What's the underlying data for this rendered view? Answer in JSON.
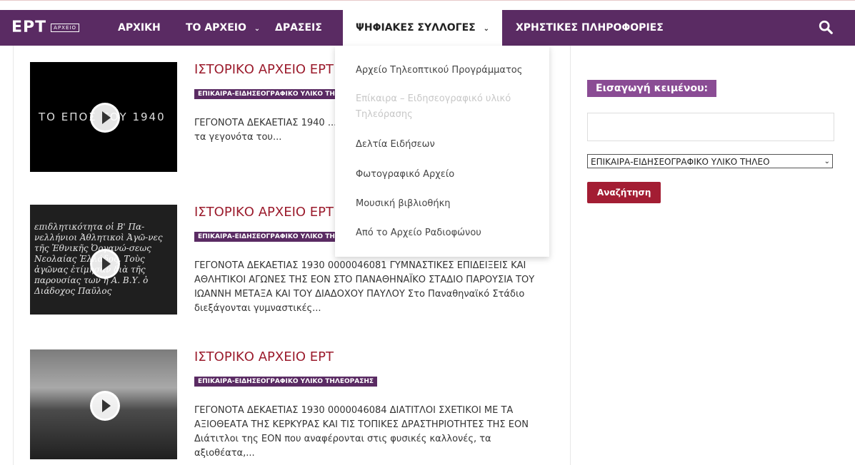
{
  "logo": {
    "text": "ΕΡΤ",
    "badge": "ΑΡΧΕΙΟ"
  },
  "nav": {
    "home": "ΑΡΧΙΚΗ",
    "archive": "ΤΟ ΑΡΧΕΙΟ",
    "actions": "ΔΡΑΣΕΙΣ",
    "digital": "ΨΗΦΙΑΚΕΣ ΣΥΛΛΟΓΕΣ",
    "info": "ΧΡΗΣΤΙΚΕΣ ΠΛΗΡΟΦΟΡΙΕΣ",
    "chevron": "⌄"
  },
  "dropdown": {
    "items": [
      "Αρχείο Τηλεοπτικού Προγράμματος",
      "Επίκαιρα – Ειδησεογραφικό υλικό Τηλεόρασης",
      "Δελτία Ειδήσεων",
      "Φωτογραφικό Αρχείο",
      "Μουσική βιβλιοθήκη",
      "Από το Αρχείο Ραδιοφώνου"
    ]
  },
  "articles": [
    {
      "title": "ΙΣΤΟΡΙΚΟ ΑΡΧΕΙΟ ΕΡΤ",
      "tag": "ΕΠΙΚΑΙΡΑ-ΕΙΔΗΣΕΟΓΡΑΦΙΚΟ ΥΛΙΚΟ ΤΗΛΕΟΡΑΣΗΣ",
      "excerpt": "ΓΕΓΟΝΟΤΑ ΔΕΚΑΕΤΙΑΣ 1940 ... ΑΝΑΣΚΟΠΗΣΗ ΣΤΗΝ ΙΣΤΟΡΙΑ ... παρουσιάζει τα γεγονότα του...",
      "thumb_caption": "ΤΟ ΕΠΟΣ ΤΟΥ 1940"
    },
    {
      "title": "ΙΣΤΟΡΙΚΟ ΑΡΧΕΙΟ ΕΡΤ",
      "tag": "ΕΠΙΚΑΙΡΑ-ΕΙΔΗΣΕΟΓΡΑΦΙΚΟ ΥΛΙΚΟ ΤΗΛΕΟΡΑΣΗΣ",
      "excerpt": "ΓΕΓΟΝΟΤΑ ΔΕΚΑΕΤΙΑΣ 1930 0000046081 ΓΥΜΝΑΣΤΙΚΕΣ ΕΠΙΔΕΙΞΕΙΣ ΚΑΙ ΑΘΛΗΤΙΚΟΙ ΑΓΩΝΕΣ ΤΗΣ ΕΟΝ ΣΤΟ ΠΑΝΑΘΗΝΑΪΚΟ ΣΤΑΔΙΟ ΠΑΡΟΥΣΙΑ ΤΟΥ ΙΩΑΝΝΗ ΜΕΤΑΞΑ ΚΑΙ ΤΟΥ ΔΙΑΔΟΧΟΥ ΠΑΥΛΟΥ Στο Παναθηναϊκό Στάδιο διεξάγονται γυμναστικές...",
      "thumb_caption": "επιδλητικότητα οἱ Β' Πα-νελλήνιοι Ἀθλητικοὶ Ἀγῶ-νες τῆς Ἐθνικῆς Ὀργανώ-σεως Νεολαίας Ἑλλάδος. Τοὺς ἀγῶνας ἐτίμησαν διὰ τῆς παρουσίας των ἡ Α. Β.Υ. ὁ Διάδοχος Παῦλος"
    },
    {
      "title": "ΙΣΤΟΡΙΚΟ ΑΡΧΕΙΟ ΕΡΤ",
      "tag": "ΕΠΙΚΑΙΡΑ-ΕΙΔΗΣΕΟΓΡΑΦΙΚΟ ΥΛΙΚΟ ΤΗΛΕΟΡΑΣΗΣ",
      "excerpt": "ΓΕΓΟΝΟΤΑ ΔΕΚΑΕΤΙΑΣ 1930 0000046084 ΔΙΑΤΙΤΛΟΙ ΣΧΕΤΙΚΟΙ ΜΕ ΤΑ ΑΞΙΟΘΕΑΤΑ ΤΗΣ ΚΕΡΚΥΡΑΣ ΚΑΙ ΤΙΣ ΤΟΠΙΚΕΣ ΔΡΑΣΤΗΡΙΟΤΗΤΕΣ ΤΗΣ ΕΟΝ Διάτιτλοι της ΕΟΝ που αναφέρονται στις φυσικές καλλονές, τα αξιοθέατα,...",
      "thumb_caption": ""
    }
  ],
  "sidebar": {
    "title": "Εισαγωγή κειμένου:",
    "input_value": "",
    "select_value": "ΕΠΙΚΑΙΡΑ-ΕΙΔΗΣΕΟΓΡΑΦΙΚΟ ΥΛΙΚΟ ΤΗΛΕΟ",
    "button": "Αναζήτηση"
  },
  "colors": {
    "brand_purple": "#5a2b63",
    "title_red": "#9b1b2c",
    "button_red": "#a31d33",
    "tag_purple": "#8a4c94"
  }
}
